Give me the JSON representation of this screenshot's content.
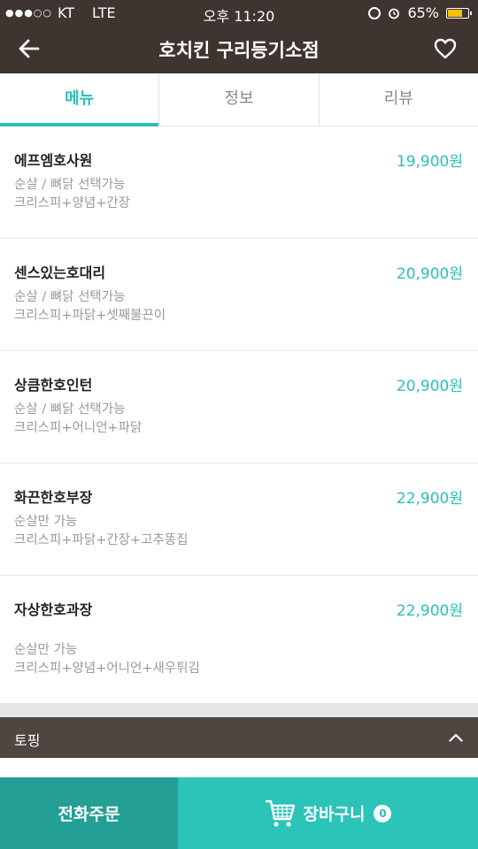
{
  "status_bar": {
    "carrier_signal": "●●●○○",
    "carrier": "KT",
    "network": "LTE",
    "time": "오후 11:20",
    "battery_percent": "65%",
    "battery_level": 0.65
  },
  "header": {
    "title": "호치킨 구리등기소점",
    "back_icon": "back-arrow-icon",
    "favorite_icon": "heart-icon"
  },
  "tabs": [
    {
      "label": "메뉴",
      "active": true
    },
    {
      "label": "정보",
      "active": false
    },
    {
      "label": "리뷰",
      "active": false
    }
  ],
  "menu_items": [
    {
      "name": "에프엠호사원",
      "price": "19,900원",
      "desc1": "순살 / 뼈닭 선택가능",
      "desc2": "크리스피+양념+간장"
    },
    {
      "name": "센스있는호대리",
      "price": "20,900원",
      "desc1": "순살 / 뼈닭 선택가능",
      "desc2": "크리스피+파닭+셋째불끈이"
    },
    {
      "name": "상큼한호인턴",
      "price": "20,900원",
      "desc1": "순살 / 뼈닭 선택가능",
      "desc2": "크리스피+어니언+파닭"
    },
    {
      "name": "화끈한호부장",
      "price": "22,900원",
      "desc1": "순살만 가능",
      "desc2": "크리스피+파닭+간장+고추똥집"
    },
    {
      "name": "자상한호과장",
      "price": "22,900원",
      "desc1": "순살만 가능",
      "desc2": "크리스피+양념+어니언+새우튀김"
    }
  ],
  "topping": {
    "label": "토핑",
    "icon": "chevron-up-icon"
  },
  "bottom_bar": {
    "phone_order_label": "전화주문",
    "cart_label": "장바구니",
    "cart_count": "0",
    "cart_icon": "shopping-cart-icon"
  },
  "colors": {
    "accent": "#2bbfb6",
    "header_bg": "#3e3430",
    "topping_bg": "#4f4641",
    "phone_btn": "#239f96",
    "cart_btn": "#2cc3b9"
  }
}
